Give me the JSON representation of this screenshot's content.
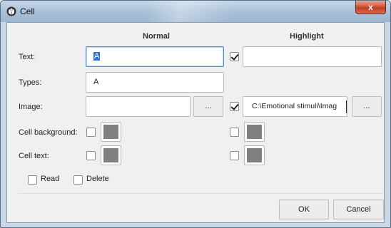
{
  "window": {
    "title": "Cell",
    "close_symbol": "x"
  },
  "headers": {
    "normal": "Normal",
    "highlight": "Highlight"
  },
  "rows": {
    "text": {
      "label": "Text:",
      "normal_value": "A",
      "highlight_checked": true,
      "highlight_value": ""
    },
    "types": {
      "label": "Types:",
      "value": "A"
    },
    "image": {
      "label": "Image:",
      "normal_value": "",
      "browse_label": "...",
      "highlight_checked": true,
      "highlight_value": "C:\\Emotional stimuli\\Imag"
    },
    "cell_background": {
      "label": "Cell background:",
      "normal_checked": false,
      "highlight_checked": false,
      "normal_color": "#808080",
      "highlight_color": "#808080"
    },
    "cell_text": {
      "label": "Cell text:",
      "normal_checked": false,
      "highlight_checked": false,
      "normal_color": "#808080",
      "highlight_color": "#808080"
    }
  },
  "options": {
    "read_label": "Read",
    "read_checked": false,
    "delete_label": "Delete",
    "delete_checked": false
  },
  "buttons": {
    "ok": "OK",
    "cancel": "Cancel"
  }
}
